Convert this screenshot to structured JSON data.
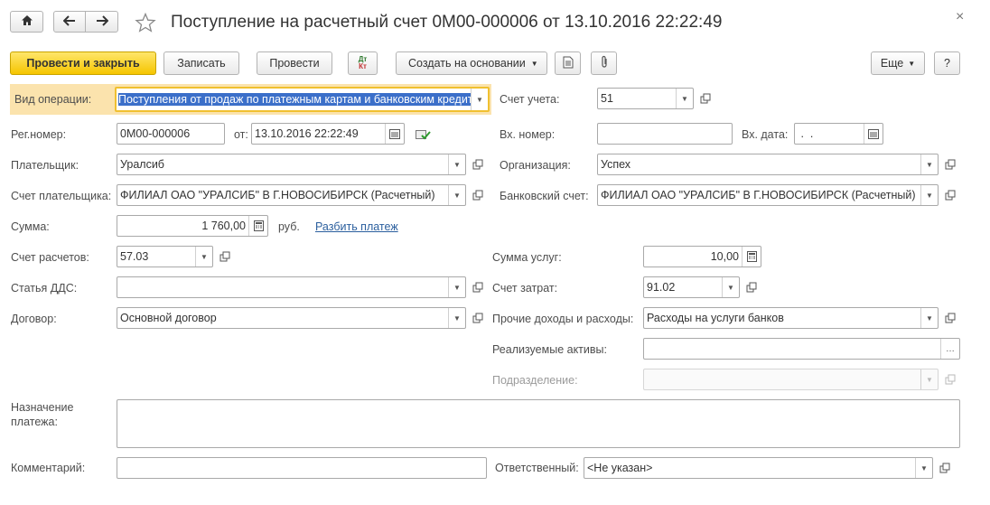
{
  "window": {
    "title": "Поступление на расчетный счет 0М00-000006 от 13.10.2016 22:22:49",
    "close_glyph": "×"
  },
  "toolbar": {
    "post_close": "Провести и закрыть",
    "save": "Записать",
    "post": "Провести",
    "dtkt_top": "Дт",
    "dtkt_bottom": "Кт",
    "create_based": "Создать на основании",
    "more": "Еще",
    "help": "?"
  },
  "form": {
    "op_type": {
      "label": "Вид операции:",
      "value": "Поступления от продаж по платежным картам и банковским кредитам"
    },
    "account": {
      "label": "Счет учета:",
      "value": "51"
    },
    "reg_number": {
      "label": "Рег.номер:",
      "value": "0М00-000006"
    },
    "reg_date": {
      "label": "от:",
      "value": "13.10.2016 22:22:49"
    },
    "in_number": {
      "label": "Вх. номер:",
      "value": ""
    },
    "in_date": {
      "label": "Вх. дата:",
      "value": " .  . "
    },
    "payer": {
      "label": "Плательщик:",
      "value": "Уралсиб"
    },
    "organization": {
      "label": "Организация:",
      "value": "Успех"
    },
    "payer_account": {
      "label": "Счет плательщика:",
      "value": "ФИЛИАЛ ОАО \"УРАЛСИБ\" В Г.НОВОСИБИРСК (Расчетный)"
    },
    "bank_account": {
      "label": "Банковский счет:",
      "value": "ФИЛИАЛ ОАО \"УРАЛСИБ\" В Г.НОВОСИБИРСК (Расчетный)"
    },
    "amount": {
      "label": "Сумма:",
      "value": "1 760,00",
      "currency": "руб.",
      "split_link": "Разбить платеж"
    },
    "settlement_account": {
      "label": "Счет расчетов:",
      "value": "57.03"
    },
    "services_amount": {
      "label": "Сумма услуг:",
      "value": "10,00"
    },
    "dds_item": {
      "label": "Статья ДДС:",
      "value": ""
    },
    "expense_account": {
      "label": "Счет затрат:",
      "value": "91.02"
    },
    "contract": {
      "label": "Договор:",
      "value": "Основной договор"
    },
    "other_income": {
      "label": "Прочие доходы и расходы:",
      "value": "Расходы на услуги банков"
    },
    "sold_assets": {
      "label": "Реализуемые активы:",
      "value": ""
    },
    "division": {
      "label": "Подразделение:",
      "value": ""
    },
    "purpose": {
      "label_line1": "Назначение",
      "label_line2": "платежа:",
      "value": ""
    },
    "comment": {
      "label": "Комментарий:",
      "value": ""
    },
    "responsible": {
      "label": "Ответственный:",
      "value": "<Не указан>"
    }
  }
}
